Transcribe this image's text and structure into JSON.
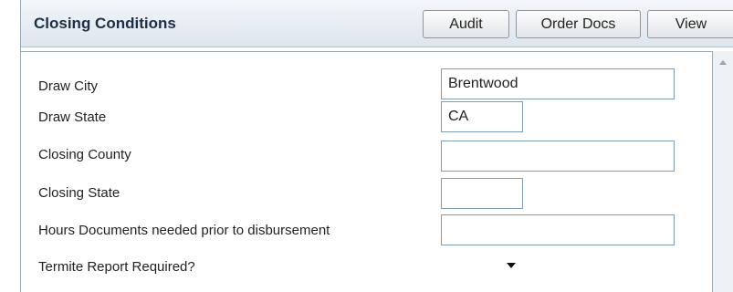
{
  "header": {
    "title": "Closing Conditions",
    "buttons": {
      "audit": "Audit",
      "order_docs": "Order Docs",
      "view": "View"
    }
  },
  "form": {
    "draw_city": {
      "label": "Draw City",
      "value": "Brentwood"
    },
    "draw_state": {
      "label": "Draw State",
      "value": "CA"
    },
    "closing_county": {
      "label": "Closing County",
      "value": ""
    },
    "closing_state": {
      "label": "Closing State",
      "value": ""
    },
    "hours_documents": {
      "label": "Hours Documents needed prior to disbursement",
      "value": ""
    },
    "termite_report": {
      "label": "Termite Report Required?",
      "selected": ""
    }
  },
  "icons": {
    "scroll_up": "scroll-up-arrow-icon",
    "dropdown": "chevron-down-icon"
  }
}
